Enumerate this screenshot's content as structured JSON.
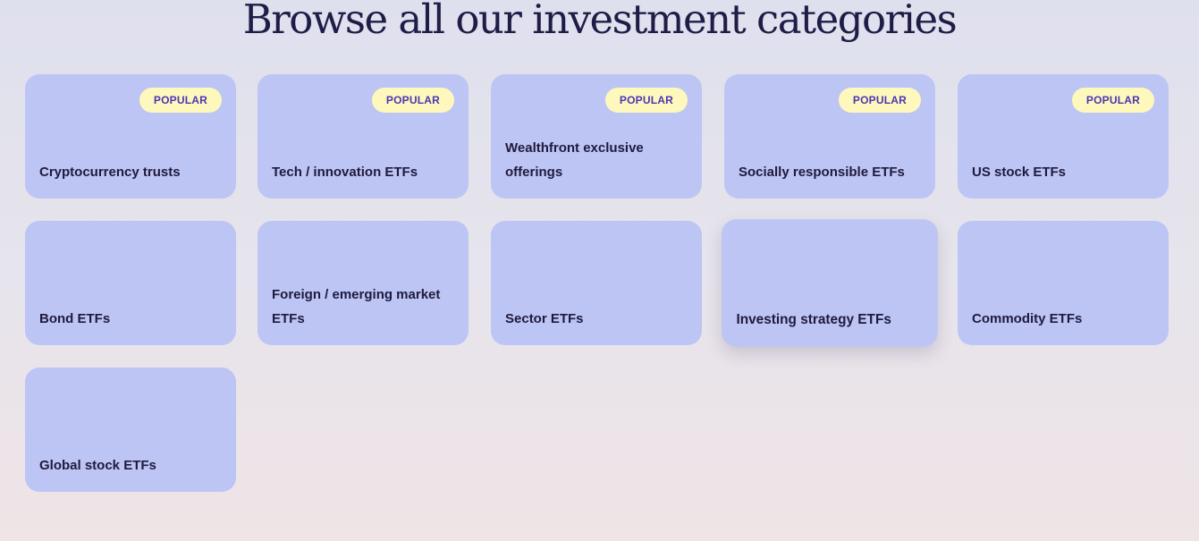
{
  "heading": "Browse all our investment categories",
  "badge_label": "POPULAR",
  "colors": {
    "card_bg": "#bdc5f4",
    "badge_bg": "#fff8bc",
    "badge_text": "#4a37b4",
    "title_text": "#1e1d47"
  },
  "categories": [
    {
      "label": "Cryptocurrency trusts",
      "popular": true
    },
    {
      "label": "Tech / innovation ETFs",
      "popular": true
    },
    {
      "label": "Wealthfront exclusive offerings",
      "popular": true
    },
    {
      "label": "Socially responsible ETFs",
      "popular": true
    },
    {
      "label": "US stock ETFs",
      "popular": true
    },
    {
      "label": "Bond ETFs",
      "popular": false
    },
    {
      "label": "Foreign / emerging market ETFs",
      "popular": false
    },
    {
      "label": "Sector ETFs",
      "popular": false
    },
    {
      "label": "Investing strategy ETFs",
      "popular": false,
      "hovered": true
    },
    {
      "label": "Commodity ETFs",
      "popular": false
    },
    {
      "label": "Global stock ETFs",
      "popular": false
    }
  ]
}
